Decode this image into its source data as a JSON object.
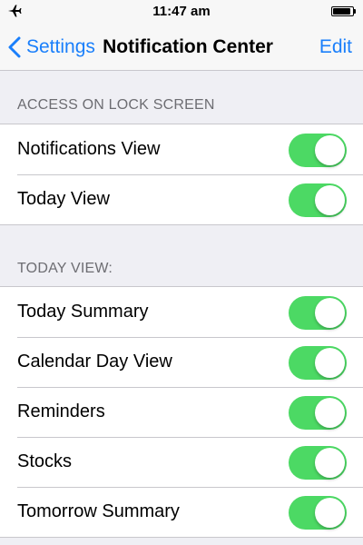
{
  "status_bar": {
    "time": "11:47 am",
    "icons": [
      "airplane-icon",
      "battery-icon"
    ]
  },
  "nav": {
    "back_label": "Settings",
    "title": "Notification Center",
    "edit_label": "Edit"
  },
  "accent_color": "#1a7ffb",
  "toggle_on_color": "#4cd964",
  "sections": [
    {
      "header": "ACCESS ON LOCK SCREEN",
      "rows": [
        {
          "label": "Notifications View",
          "on": true
        },
        {
          "label": "Today View",
          "on": true
        }
      ]
    },
    {
      "header": "TODAY VIEW:",
      "rows": [
        {
          "label": "Today Summary",
          "on": true
        },
        {
          "label": "Calendar Day View",
          "on": true
        },
        {
          "label": "Reminders",
          "on": true
        },
        {
          "label": "Stocks",
          "on": true
        },
        {
          "label": "Tomorrow Summary",
          "on": true
        }
      ]
    }
  ]
}
